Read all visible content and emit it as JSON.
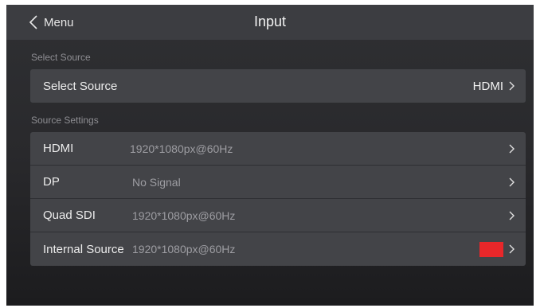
{
  "header": {
    "back_label": "Menu",
    "title": "Input"
  },
  "select_source_section": {
    "label": "Select Source",
    "row": {
      "name": "Select Source",
      "value": "HDMI"
    }
  },
  "source_settings_section": {
    "label": "Source Settings",
    "rows": [
      {
        "name": "HDMI",
        "value": "1920*1080px@60Hz"
      },
      {
        "name": "DP",
        "value": "No Signal"
      },
      {
        "name": "Quad SDI",
        "value": "1920*1080px@60Hz"
      },
      {
        "name": "Internal Source",
        "value": "1920*1080px@60Hz",
        "swatch_color": "#e8272a"
      }
    ]
  },
  "colors": {
    "background": "#2a2a2d",
    "card": "#434448",
    "header_bar": "#3c3d41",
    "text": "#ececec",
    "secondary_text": "#9d9da2",
    "internal_source_swatch": "#e8272a"
  }
}
